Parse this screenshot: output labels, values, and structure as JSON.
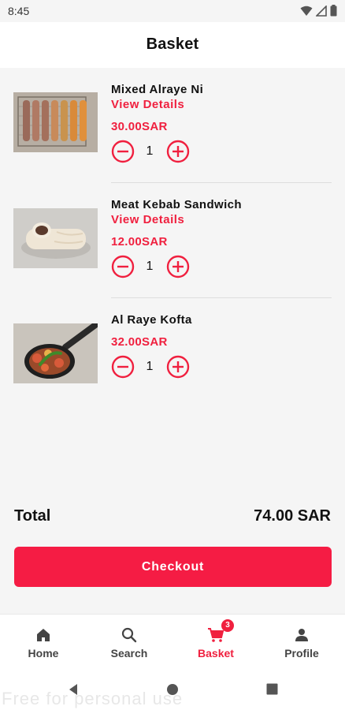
{
  "status_bar": {
    "time": "8:45"
  },
  "header": {
    "title": "Basket"
  },
  "items": [
    {
      "name": "Mixed Alraye Ni",
      "link": "View Details",
      "price": "30.00SAR",
      "quantity": "1"
    },
    {
      "name": "Meat Kebab Sandwich",
      "link": "View Details",
      "price": "12.00SAR",
      "quantity": "1"
    },
    {
      "name": "Al Raye Kofta",
      "price": "32.00SAR",
      "quantity": "1"
    }
  ],
  "summary": {
    "total_label": "Total",
    "total_value": "74.00 SAR",
    "checkout_label": "Checkout"
  },
  "bottom_nav": {
    "items": [
      {
        "label": "Home",
        "icon": "home-icon"
      },
      {
        "label": "Search",
        "icon": "search-icon"
      },
      {
        "label": "Basket",
        "icon": "cart-icon",
        "badge": "3",
        "active": true
      },
      {
        "label": "Profile",
        "icon": "person-icon"
      }
    ]
  },
  "watermark": "Free for personal use",
  "colors": {
    "accent": "#f0203f",
    "checkout": "#f51c44",
    "background": "#f5f5f5"
  }
}
